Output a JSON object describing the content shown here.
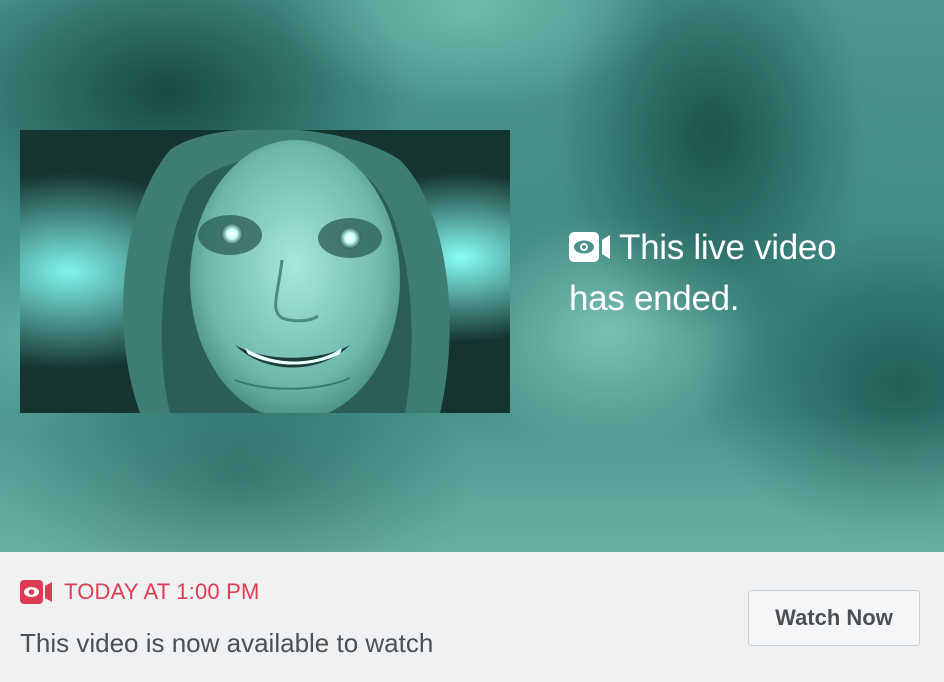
{
  "video": {
    "ended_message": "This live video has ended.",
    "live_icon": "live-video-icon",
    "thumbnail_icon": "face-thumbnail-image"
  },
  "footer": {
    "schedule_icon": "live-video-icon",
    "schedule_text": "TODAY AT 1:00 PM",
    "description": "This video is now available to watch",
    "watch_button_label": "Watch Now"
  },
  "colors": {
    "accent_red": "#dd3c53",
    "text_gray": "#4b4f56",
    "footer_bg": "#f0f1f3",
    "video_teal": "#3f8a83"
  }
}
